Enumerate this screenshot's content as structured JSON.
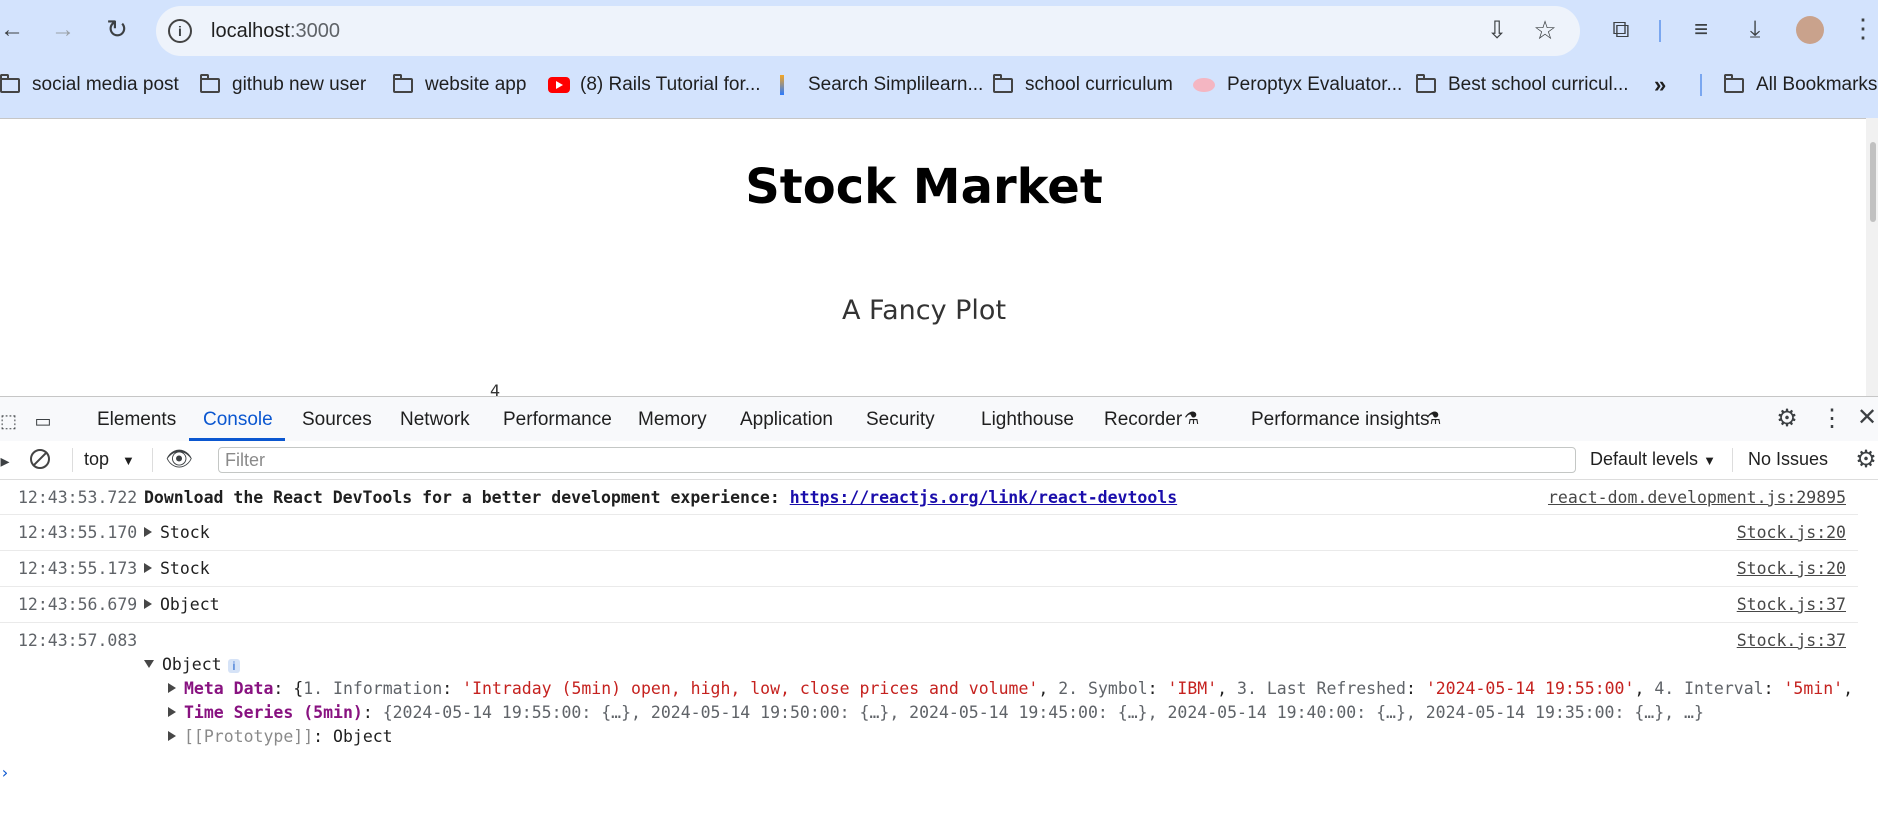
{
  "browser": {
    "url_host": "localhost",
    "url_port": ":3000",
    "bookmarks": [
      {
        "label": "social media post",
        "icon": "folder-icon"
      },
      {
        "label": "github new user",
        "icon": "folder-icon"
      },
      {
        "label": "website app",
        "icon": "folder-icon"
      },
      {
        "label": "(8) Rails Tutorial for...",
        "icon": "youtube-icon"
      },
      {
        "label": "Search Simplilearn...",
        "icon": "simplilearn-icon"
      },
      {
        "label": "school curriculum",
        "icon": "folder-icon"
      },
      {
        "label": "Peroptyx Evaluator...",
        "icon": "peroptyx-icon"
      },
      {
        "label": "Best school curricul...",
        "icon": "folder-icon"
      }
    ],
    "overflow_chevron": "»",
    "all_bookmarks": "All Bookmarks"
  },
  "page": {
    "title": "Stock Market",
    "chart_title": "A Fancy Plot",
    "axis_glimpse": "4"
  },
  "devtools": {
    "tabs": [
      "Elements",
      "Console",
      "Sources",
      "Network",
      "Performance",
      "Memory",
      "Application",
      "Security",
      "Lighthouse",
      "Recorder",
      "Performance insights"
    ],
    "active_tab": "Console",
    "context": "top",
    "filter_placeholder": "Filter",
    "levels": "Default levels",
    "issues": "No Issues",
    "logs": [
      {
        "time": "12:43:53.722",
        "message": "Download the React DevTools for a better development experience: ",
        "link": "https://reactjs.org/link/react-devtools",
        "source": "react-dom.development.js:29895"
      },
      {
        "time": "12:43:55.170",
        "message": "Stock",
        "source": "Stock.js:20"
      },
      {
        "time": "12:43:55.173",
        "message": "Stock",
        "source": "Stock.js:20"
      },
      {
        "time": "12:43:56.679",
        "message": "Object",
        "source": "Stock.js:37"
      },
      {
        "time": "12:43:57.083",
        "message": "Object",
        "source": "Stock.js:37"
      }
    ],
    "expanded": {
      "info_badge": "i",
      "meta_key": "Meta Data",
      "meta_p1_key": "1. Information",
      "meta_p1_val": "'Intraday (5min) open, high, low, close prices and volume'",
      "meta_p2_key": "2. Symbol",
      "meta_p2_val": "'IBM'",
      "meta_p3_key": "3. Last Refreshed",
      "meta_p3_val": "'2024-05-14 19:55:00'",
      "meta_p4_key": "4. Interval",
      "meta_p4_val": "'5min'",
      "ts_key": "Time Series (5min)",
      "ts_preview": "{2024-05-14 19:55:00: {…}, 2024-05-14 19:50:00: {…}, 2024-05-14 19:45:00: {…}, 2024-05-14 19:40:00: {…}, 2024-05-14 19:35:00: {…}, …}",
      "proto_key": "[[Prototype]]",
      "proto_val": "Object"
    }
  }
}
